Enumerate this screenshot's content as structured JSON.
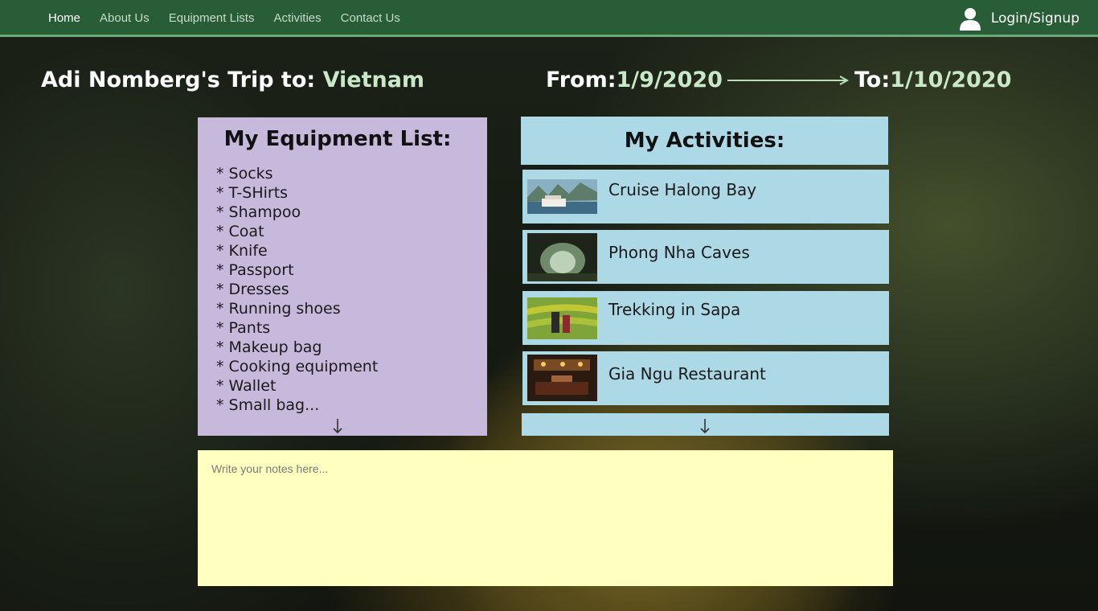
{
  "nav": {
    "links": [
      "Home",
      "About Us",
      "Equipment Lists",
      "Activities",
      "Contact Us"
    ],
    "login": "Login/Signup"
  },
  "trip": {
    "owner_prefix": "Adi Nomberg's Trip to: ",
    "destination": "Vietnam",
    "from_label": "From: ",
    "from_date": "1/9/2020",
    "to_label": "To: ",
    "to_date": "1/10/2020"
  },
  "equipment": {
    "title": "My Equipment List:",
    "items": [
      "* Socks",
      "* T-SHirts",
      "* Shampoo",
      "* Coat",
      "* Knife",
      "* Passport",
      "* Dresses",
      "* Running shoes",
      "* Pants",
      "* Makeup bag",
      "* Cooking equipment",
      "* Wallet",
      "* Small bag..."
    ]
  },
  "activities": {
    "title": "My Activities:",
    "items": [
      {
        "name": "Cruise Halong Bay"
      },
      {
        "name": "Phong Nha Caves"
      },
      {
        "name": "Trekking in Sapa"
      },
      {
        "name": "Gia Ngu Restaurant"
      }
    ]
  },
  "notes": {
    "placeholder": "Write your notes here..."
  },
  "colors": {
    "navbar": "#285d37",
    "equipment_panel": "#c6b9dc",
    "activities_panel": "#add8e6",
    "notes_panel": "#ffffc0",
    "highlight": "#c8e8c8"
  },
  "icons": [
    "user-icon",
    "arrow-right-icon",
    "arrow-down-icon"
  ]
}
